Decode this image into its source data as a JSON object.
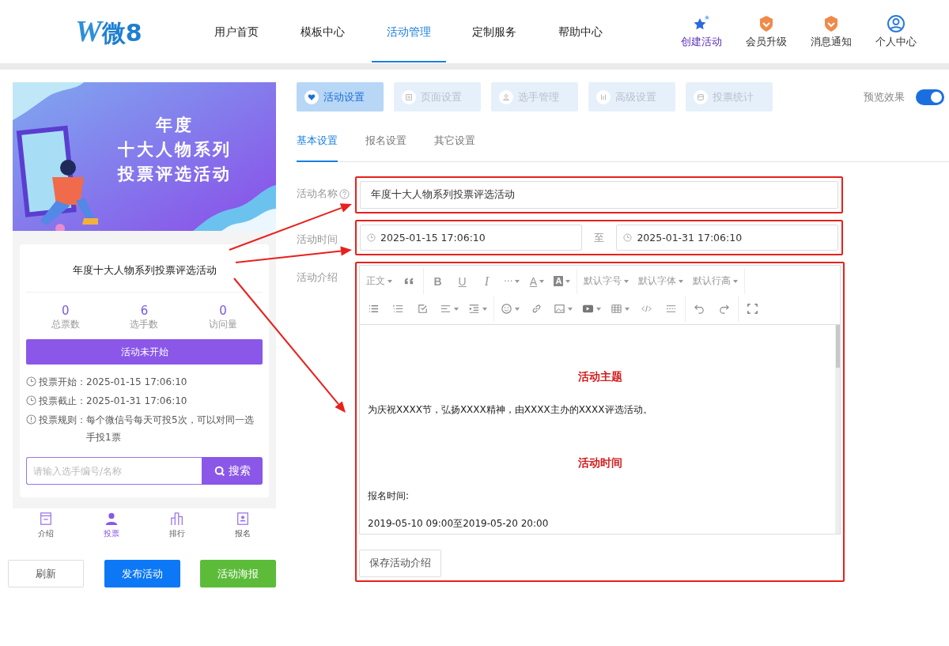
{
  "header": {
    "logo": {
      "mark": "W",
      "text": "微8"
    },
    "nav": [
      {
        "label": "用户首页",
        "selected": false
      },
      {
        "label": "模板中心",
        "selected": false
      },
      {
        "label": "活动管理",
        "selected": true
      },
      {
        "label": "定制服务",
        "selected": false
      },
      {
        "label": "帮助中心",
        "selected": false
      }
    ],
    "actions": [
      {
        "kind": "star",
        "label": "创建活动"
      },
      {
        "kind": "medal",
        "label": "会员升级"
      },
      {
        "kind": "medal",
        "label": "消息通知"
      },
      {
        "kind": "user",
        "label": "个人中心"
      }
    ]
  },
  "preview": {
    "banner": {
      "lines": [
        "年度",
        "十大人物系列",
        "投票评选活动"
      ]
    },
    "card": {
      "title": "年度十大人物系列投票评选活动",
      "stats": [
        {
          "value": "0",
          "label": "总票数"
        },
        {
          "value": "6",
          "label": "选手数"
        },
        {
          "value": "0",
          "label": "访问量"
        }
      ],
      "status": "活动未开始",
      "info": [
        {
          "kind": "clock",
          "label": "投票开始：",
          "value": "2025-01-15 17:06:10"
        },
        {
          "kind": "clock",
          "label": "投票截止：",
          "value": "2025-01-31 17:06:10"
        },
        {
          "kind": "info",
          "label": "投票规则：",
          "value": "每个微信号每天可投5次，可以对同一选手投1票"
        }
      ],
      "search": {
        "placeholder": "请输入选手编号/名称",
        "button": "搜索"
      }
    },
    "tabbar": [
      {
        "kind": "intro",
        "label": "介绍",
        "selected": false
      },
      {
        "kind": "vote",
        "label": "投票",
        "selected": true
      },
      {
        "kind": "rank",
        "label": "排行",
        "selected": false
      },
      {
        "kind": "signup",
        "label": "报名",
        "selected": false
      }
    ]
  },
  "buttons": [
    {
      "kind": "default",
      "label": "刷新"
    },
    {
      "kind": "primary",
      "label": "发布活动"
    },
    {
      "kind": "success",
      "label": "活动海报"
    }
  ],
  "steps": [
    {
      "kind": "heart",
      "label": "活动设置",
      "selected": true
    },
    {
      "kind": "page",
      "label": "页面设置",
      "selected": false
    },
    {
      "kind": "person",
      "label": "选手管理",
      "selected": false
    },
    {
      "kind": "advanced",
      "label": "高级设置",
      "selected": false
    },
    {
      "kind": "stats",
      "label": "投票统计",
      "selected": false
    }
  ],
  "preview_toggle": {
    "label": "预览效果",
    "on": true
  },
  "subtabs": [
    {
      "label": "基本设置",
      "selected": true
    },
    {
      "label": "报名设置",
      "selected": false
    },
    {
      "label": "其它设置",
      "selected": false
    }
  ],
  "form": {
    "name": {
      "label": "活动名称",
      "value": "年度十大人物系列投票评选活动"
    },
    "time": {
      "label": "活动时间",
      "start": "2025-01-15 17:06:10",
      "separator": "至",
      "end": "2025-01-31 17:06:10"
    },
    "intro": {
      "label": "活动介绍",
      "toolbar": {
        "paragraph": "正文",
        "bold": "B",
        "underline": "U",
        "italic": "I",
        "more": "···",
        "font_color": "A",
        "bg_color": "A",
        "font_size": "默认字号",
        "font_family": "默认字体",
        "line_height": "默认行高"
      },
      "content": [
        {
          "kind": "heading",
          "text": "活动主题"
        },
        {
          "kind": "paragraph",
          "text": "为庆祝XXXX节，弘扬XXXX精神，由XXXX主办的XXXX评选活动。"
        },
        {
          "kind": "heading",
          "text": "活动时间"
        },
        {
          "kind": "paragraph",
          "text": "报名时间:"
        },
        {
          "kind": "paragraph",
          "text": "2019-05-10 09:00至2019-05-20 20:00"
        }
      ],
      "save": "保存活动介绍"
    }
  }
}
